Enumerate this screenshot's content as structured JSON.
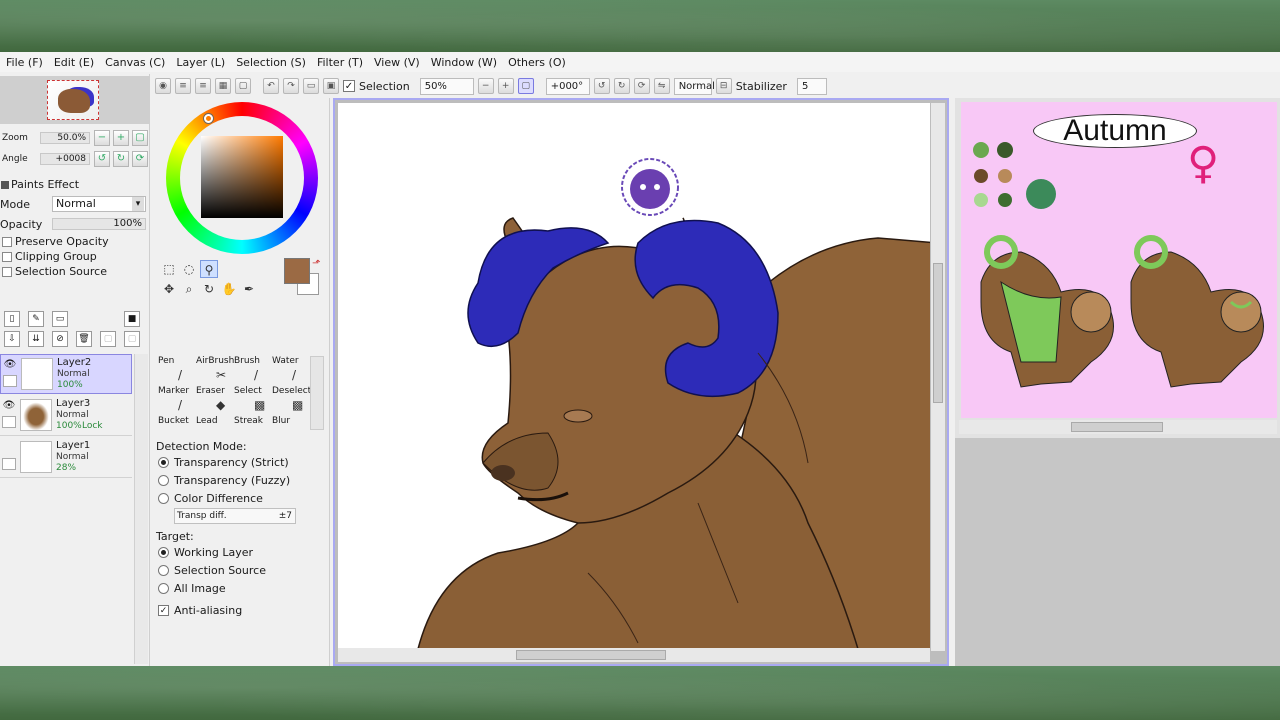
{
  "menu": [
    "File (F)",
    "Edit (E)",
    "Canvas (C)",
    "Layer (L)",
    "Selection (S)",
    "Filter (T)",
    "View (V)",
    "Window (W)",
    "Others (O)"
  ],
  "toolbar": {
    "selection_label": "Selection",
    "zoom_value": "50%",
    "angle_value": "+000°",
    "blend_mode": "Normal",
    "stabilizer_label": "Stabilizer",
    "stabilizer_value": "5"
  },
  "navigator": {
    "zoom_label": "Zoom",
    "zoom_value": "50.0%",
    "angle_label": "Angle",
    "angle_value": "+0008"
  },
  "paints_effect": {
    "header": "Paints Effect",
    "mode_label": "Mode",
    "mode_value": "Normal",
    "opacity_label": "Opacity",
    "opacity_value": "100%",
    "preserve_opacity": "Preserve Opacity",
    "clipping_group": "Clipping Group",
    "selection_source": "Selection Source"
  },
  "layers": [
    {
      "name": "Layer2",
      "mode": "Normal",
      "opacity": "100%",
      "lock": "",
      "selected": true
    },
    {
      "name": "Layer3",
      "mode": "Normal",
      "opacity": "100%",
      "lock": "Lock",
      "selected": false
    },
    {
      "name": "Layer1",
      "mode": "Normal",
      "opacity": "28%",
      "lock": "",
      "selected": false
    }
  ],
  "brushes": [
    {
      "label": "Pen"
    },
    {
      "label": "AirBrush"
    },
    {
      "label": "Brush"
    },
    {
      "label": "Water"
    },
    {
      "label": "Marker"
    },
    {
      "label": "Eraser"
    },
    {
      "label": "Select"
    },
    {
      "label": "Deselect"
    },
    {
      "label": "Bucket"
    },
    {
      "label": "Lead"
    },
    {
      "label": "Streak"
    },
    {
      "label": "Blur"
    }
  ],
  "bucket_options": {
    "detection_header": "Detection Mode:",
    "detection_options": [
      "Transparency (Strict)",
      "Transparency (Fuzzy)",
      "Color Difference"
    ],
    "detection_selected": 0,
    "transp_diff_label": "Transp diff.",
    "transp_diff_value": "±7",
    "target_header": "Target:",
    "target_options": [
      "Working Layer",
      "Selection Source",
      "All Image"
    ],
    "target_selected": 0,
    "anti_aliasing": "Anti-aliasing"
  },
  "reference": {
    "title": "Autumn",
    "gender_symbol": "♀"
  },
  "colors": {
    "primary_color": "#9b6a44",
    "horn_blue": "#2d2bb8",
    "fur_brown": "#8f6338",
    "ref_bg": "#f8c8f6",
    "canvas_border": "#a9a9f2"
  }
}
